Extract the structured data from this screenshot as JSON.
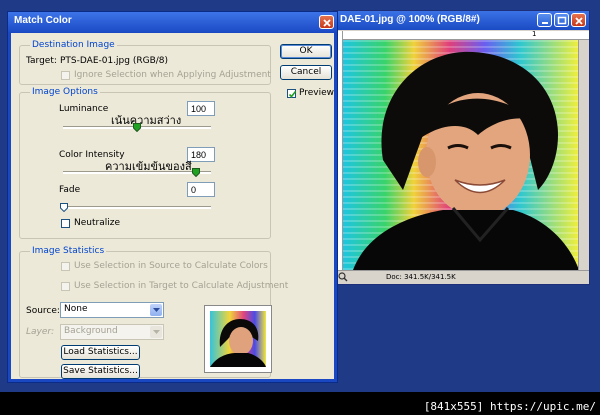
{
  "image_window": {
    "title": "DAE-01.jpg @ 100% (RGB/8#)",
    "ruler_mark": "1",
    "status": "Doc: 341.5K/341.5K"
  },
  "dialog": {
    "title": "Match Color",
    "buttons": {
      "ok": "OK",
      "cancel": "Cancel"
    },
    "preview": {
      "label": "Preview",
      "checked": true
    },
    "destination": {
      "group_label": "Destination Image",
      "target_label": "Target:",
      "target_value": "PTS-DAE-01.jpg (RGB/8)",
      "ignore_selection": "Ignore Selection when Applying Adjustment"
    },
    "image_options": {
      "group_label": "Image Options",
      "luminance": {
        "label": "Luminance",
        "value": "100",
        "range": [
          1,
          200
        ],
        "annotation": "เน้นความสว่าง"
      },
      "color_intensity": {
        "label": "Color Intensity",
        "value": "180",
        "range": [
          1,
          200
        ],
        "annotation": "ความเข้มข้นของสี"
      },
      "fade": {
        "label": "Fade",
        "value": "0",
        "range": [
          0,
          100
        ]
      },
      "neutralize": "Neutralize"
    },
    "image_statistics": {
      "group_label": "Image Statistics",
      "use_source": "Use Selection in Source to Calculate Colors",
      "use_target": "Use Selection in Target to Calculate Adjustment",
      "source_label": "Source:",
      "source_value": "None",
      "layer_label": "Layer:",
      "layer_value": "Background",
      "load_button": "Load Statistics...",
      "save_button": "Save Statistics..."
    }
  },
  "watermark": "[841x555] https://upic.me/"
}
